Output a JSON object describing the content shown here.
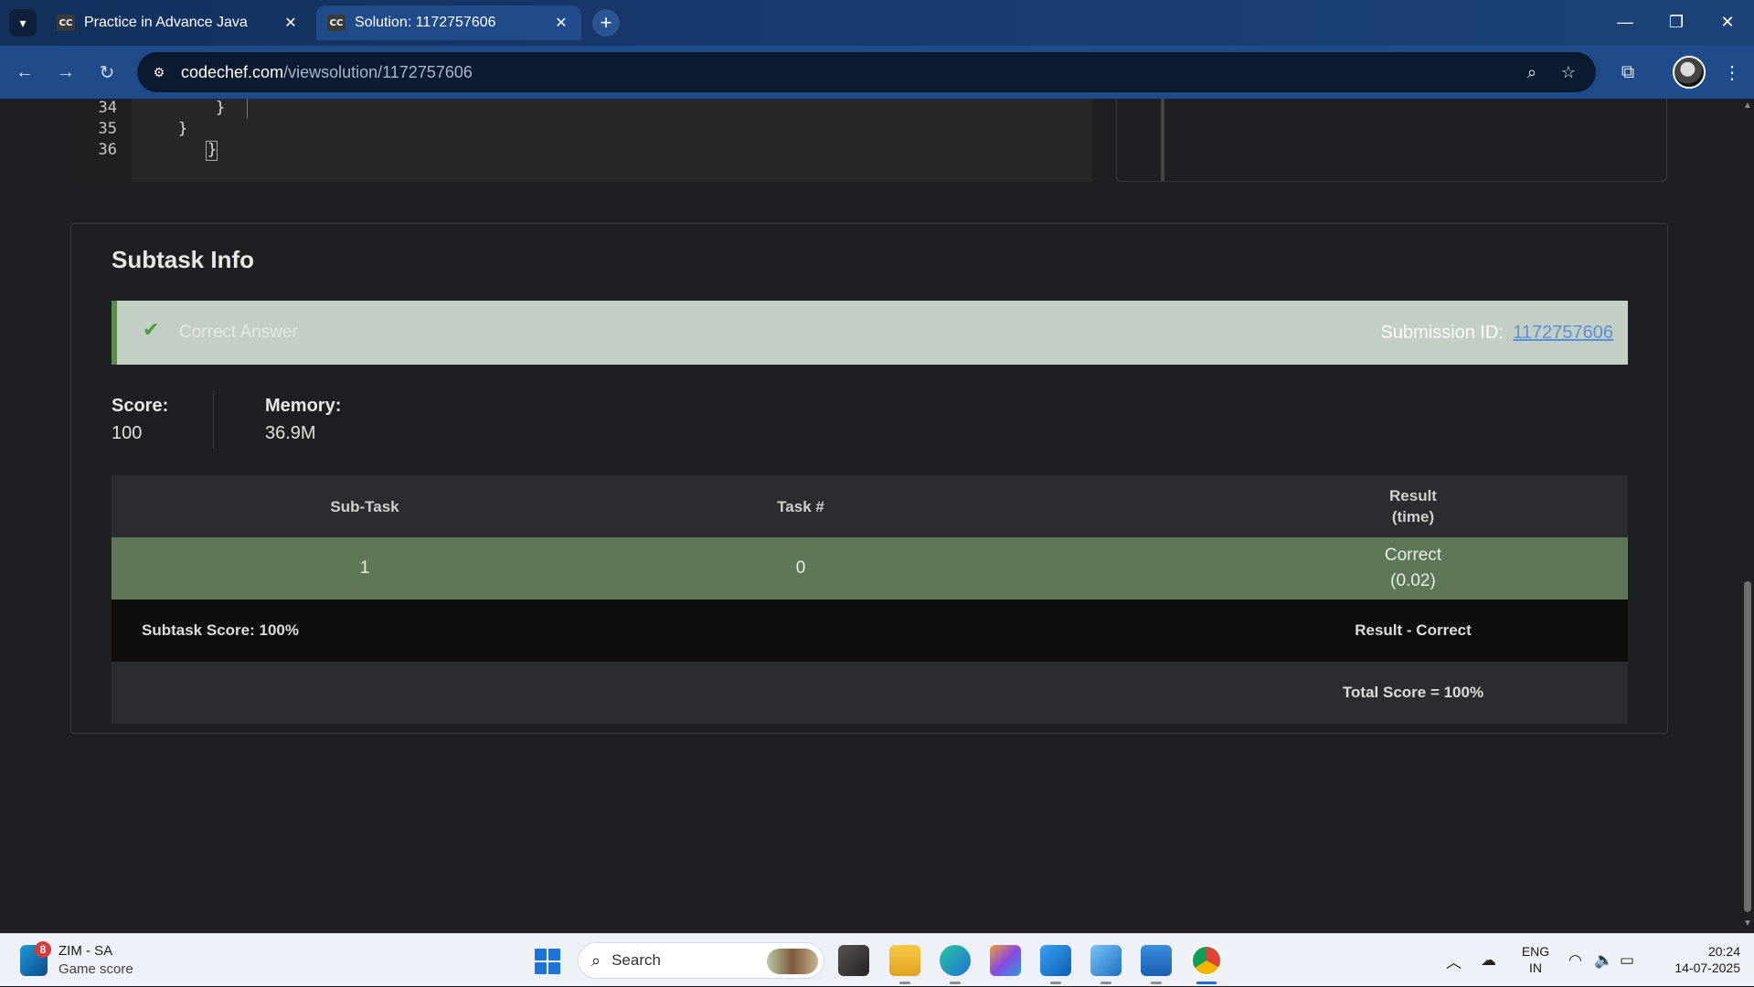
{
  "browser": {
    "tabs": [
      {
        "favicon": "CC",
        "title": "Practice in Advance Java",
        "active": false
      },
      {
        "favicon": "CC",
        "title": "Solution: 1172757606",
        "active": true
      }
    ],
    "new_tab_icon": "plus-icon",
    "url_host": "codechef.com",
    "url_path": "/viewsolution/1172757606"
  },
  "code": {
    "line_numbers": [
      "34",
      "35",
      "36"
    ],
    "lines": [
      "}",
      "}",
      "}"
    ]
  },
  "subtask": {
    "title": "Subtask Info",
    "status": "Correct Answer",
    "submission_label": "Submission ID:",
    "submission_id": "1172757606",
    "score_label": "Score:",
    "score_value": "100",
    "memory_label": "Memory:",
    "memory_value": "36.9M",
    "table": {
      "headers": {
        "subtask": "Sub-Task",
        "task": "Task #",
        "result_line1": "Result",
        "result_line2": "(time)"
      },
      "row": {
        "subtask": "1",
        "task": "0",
        "result": "Correct",
        "time": "(0.02)"
      },
      "subtask_score": "Subtask Score: 100%",
      "result_summary": "Result - Correct",
      "total_score": "Total Score = 100%"
    },
    "colors": {
      "accent_green": "#5b8a4a",
      "row_green": "#5e7757",
      "banner_bg": "#c3cfc4",
      "link": "#5b8fd6"
    }
  },
  "taskbar": {
    "widget_badge": "8",
    "widget_title": "ZIM - SA",
    "widget_subtitle": "Game score",
    "search_placeholder": "Search",
    "lang_line1": "ENG",
    "lang_line2": "IN",
    "time": "20:24",
    "date": "14-07-2025"
  }
}
